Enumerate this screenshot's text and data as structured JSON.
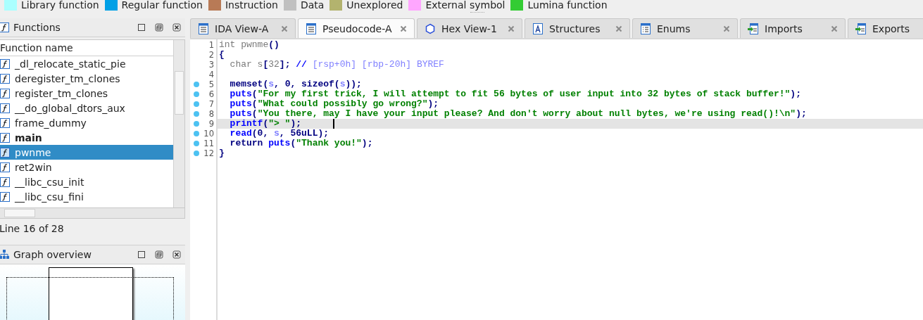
{
  "legend": [
    {
      "label": "Library function",
      "color": "#aaffff"
    },
    {
      "label": "Regular function",
      "color": "#00a0e6"
    },
    {
      "label": "Instruction",
      "color": "#b87a56"
    },
    {
      "label": "Data",
      "color": "#c0c0c0"
    },
    {
      "label": "Unexplored",
      "color": "#b3b36e"
    },
    {
      "label": "External symbol",
      "color": "#ffa6ff"
    },
    {
      "label": "Lumina function",
      "color": "#33cc33"
    }
  ],
  "functions_panel": {
    "title": "Functions",
    "column": "Function name",
    "status": "Line 16 of 28",
    "items": [
      {
        "name": "_dl_relocate_static_pie",
        "bold": false,
        "selected": false
      },
      {
        "name": "deregister_tm_clones",
        "bold": false,
        "selected": false
      },
      {
        "name": "register_tm_clones",
        "bold": false,
        "selected": false
      },
      {
        "name": "__do_global_dtors_aux",
        "bold": false,
        "selected": false
      },
      {
        "name": "frame_dummy",
        "bold": false,
        "selected": false
      },
      {
        "name": "main",
        "bold": true,
        "selected": false
      },
      {
        "name": "pwnme",
        "bold": false,
        "selected": true
      },
      {
        "name": "ret2win",
        "bold": false,
        "selected": false
      },
      {
        "name": "__libc_csu_init",
        "bold": false,
        "selected": false
      },
      {
        "name": "__libc_csu_fini",
        "bold": false,
        "selected": false
      }
    ]
  },
  "graph_panel": {
    "title": "Graph overview"
  },
  "tabs": [
    {
      "label": "IDA View-A",
      "kind": "listing",
      "selected": false
    },
    {
      "label": "Pseudocode-A",
      "kind": "pseudocode",
      "selected": true
    },
    {
      "label": "Hex View-1",
      "kind": "hex",
      "selected": false
    },
    {
      "label": "Structures",
      "kind": "structures",
      "selected": false
    },
    {
      "label": "Enums",
      "kind": "enums",
      "selected": false
    },
    {
      "label": "Imports",
      "kind": "imports",
      "selected": false
    },
    {
      "label": "Exports",
      "kind": "exports",
      "selected": false
    }
  ],
  "code": [
    {
      "number": "1",
      "breakpoint": false,
      "selected": false,
      "tokens": [
        {
          "kind": "text",
          "text": "int pwnme"
        },
        {
          "kind": "punct",
          "text": "()"
        }
      ]
    },
    {
      "number": "2",
      "breakpoint": false,
      "selected": false,
      "tokens": [
        {
          "kind": "punct",
          "text": "{"
        }
      ],
      "children": [
        {
          "number": "3",
          "breakpoint": false,
          "selected": false,
          "tokens": [
            {
              "kind": "text",
              "text": "char s"
            },
            {
              "kind": "punct",
              "text": "["
            },
            {
              "kind": "text",
              "text": "32"
            },
            {
              "kind": "punct",
              "text": "];"
            },
            {
              "kind": "comment",
              "text": " // "
            },
            {
              "kind": "annotation",
              "text": "[rsp+0h] [rbp-20h] BYREF"
            }
          ]
        },
        {
          "number": "4",
          "breakpoint": false,
          "selected": false
        },
        {
          "number": "5",
          "breakpoint": true,
          "selected": false,
          "tokens": [
            {
              "kind": "func",
              "text": "memset"
            },
            {
              "kind": "punct",
              "text": "("
            },
            {
              "kind": "var",
              "text": "s"
            },
            {
              "kind": "punct",
              "text": ", 0, sizeof("
            },
            {
              "kind": "var",
              "text": "s"
            },
            {
              "kind": "punct",
              "text": "));"
            }
          ]
        },
        {
          "number": "6",
          "breakpoint": true,
          "selected": false,
          "tokens": [
            {
              "kind": "call",
              "text": "puts"
            },
            {
              "kind": "punct",
              "text": "("
            },
            {
              "kind": "string",
              "text": "\"For my first trick, I will attempt to fit 56 bytes of user input into 32 bytes of stack buffer!\""
            },
            {
              "kind": "punct",
              "text": ");"
            }
          ]
        },
        {
          "number": "7",
          "breakpoint": true,
          "selected": false,
          "tokens": [
            {
              "kind": "call",
              "text": "puts"
            },
            {
              "kind": "punct",
              "text": "("
            },
            {
              "kind": "string",
              "text": "\"What could possibly go wrong?\""
            },
            {
              "kind": "punct",
              "text": ");"
            }
          ]
        },
        {
          "number": "8",
          "breakpoint": true,
          "selected": false,
          "tokens": [
            {
              "kind": "call",
              "text": "puts"
            },
            {
              "kind": "punct",
              "text": "("
            },
            {
              "kind": "string",
              "text": "\"You there, may I have your input please? And don't worry about null bytes, we're using read()!\\n\""
            },
            {
              "kind": "punct",
              "text": ");"
            }
          ]
        },
        {
          "number": "9",
          "breakpoint": true,
          "selected": true,
          "tokens": [
            {
              "kind": "call",
              "text": "printf"
            },
            {
              "kind": "punct",
              "text": "("
            },
            {
              "kind": "string",
              "text": "\"> \""
            },
            {
              "kind": "punct",
              "text": ");"
            }
          ]
        },
        {
          "number": "10",
          "breakpoint": true,
          "selected": false,
          "tokens": [
            {
              "kind": "call",
              "text": "read"
            },
            {
              "kind": "punct",
              "text": "(0, "
            },
            {
              "kind": "var",
              "text": "s"
            },
            {
              "kind": "punct",
              "text": ", 56uLL);"
            }
          ]
        },
        {
          "number": "11",
          "breakpoint": true,
          "selected": false,
          "tokens": [
            {
              "kind": "punct",
              "text": "return "
            },
            {
              "kind": "call",
              "text": "puts"
            },
            {
              "kind": "punct",
              "text": "("
            },
            {
              "kind": "string",
              "text": "\"Thank you!\""
            },
            {
              "kind": "punct",
              "text": ");"
            }
          ]
        }
      ]
    },
    {
      "number": "12",
      "breakpoint": true,
      "selected": false,
      "tokens": [
        {
          "kind": "punct",
          "text": "}"
        }
      ]
    }
  ]
}
